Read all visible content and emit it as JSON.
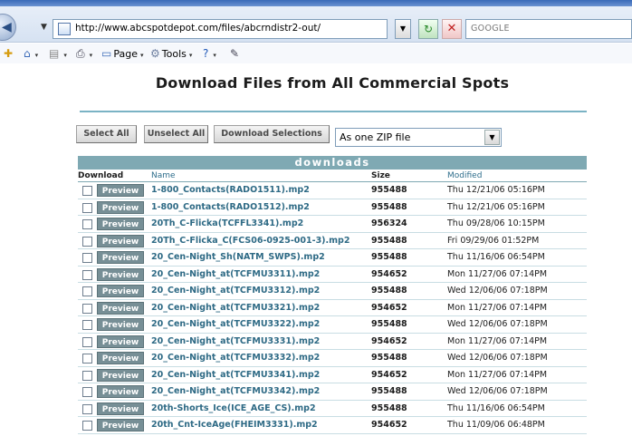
{
  "browser": {
    "url": "http://www.abcspotdepot.com/files/abcrndistr2-out/",
    "search_text": "GOOGLE",
    "back_glyph": "◀",
    "dropdown_glyph": "▼",
    "refresh_glyph": "↻",
    "stop_glyph": "✕",
    "commands": {
      "page": "Page",
      "tools": "Tools"
    },
    "icons": {
      "favorites": "✚",
      "home": "⌂",
      "feeds": "▤",
      "print": "⎙",
      "page": "▭",
      "tools": "⚙",
      "help": "?",
      "research": "✎",
      "dropdown": "▾"
    }
  },
  "page": {
    "title": "Download Files from All Commercial Spots",
    "buttons": {
      "select_all": "Select All",
      "unselect_all": "Unselect All",
      "download_selections": "Download Selections"
    },
    "format_select": {
      "value": "As one ZIP file",
      "arrow": "▼"
    }
  },
  "table": {
    "title": "downloads",
    "columns": {
      "download": "Download",
      "name": "Name",
      "size": "Size",
      "modified": "Modified"
    },
    "preview_label": "Preview",
    "rows": [
      {
        "name": "1-800_Contacts(RADO1511).mp2",
        "size": "955488",
        "modified": "Thu 12/21/06 05:16PM"
      },
      {
        "name": "1-800_Contacts(RADO1512).mp2",
        "size": "955488",
        "modified": "Thu 12/21/06 05:16PM"
      },
      {
        "name": "20Th_C-Flicka(TCFFL3341).mp2",
        "size": "956324",
        "modified": "Thu 09/28/06 10:15PM"
      },
      {
        "name": "20Th_C-Flicka_C(FCS06-0925-001-3).mp2",
        "size": "955488",
        "modified": "Fri 09/29/06 01:52PM"
      },
      {
        "name": "20_Cen-Night_Sh(NATM_SWPS).mp2",
        "size": "955488",
        "modified": "Thu 11/16/06 06:54PM"
      },
      {
        "name": "20_Cen-Night_at(TCFMU3311).mp2",
        "size": "954652",
        "modified": "Mon 11/27/06 07:14PM"
      },
      {
        "name": "20_Cen-Night_at(TCFMU3312).mp2",
        "size": "955488",
        "modified": "Wed 12/06/06 07:18PM"
      },
      {
        "name": "20_Cen-Night_at(TCFMU3321).mp2",
        "size": "954652",
        "modified": "Mon 11/27/06 07:14PM"
      },
      {
        "name": "20_Cen-Night_at(TCFMU3322).mp2",
        "size": "955488",
        "modified": "Wed 12/06/06 07:18PM"
      },
      {
        "name": "20_Cen-Night_at(TCFMU3331).mp2",
        "size": "954652",
        "modified": "Mon 11/27/06 07:14PM"
      },
      {
        "name": "20_Cen-Night_at(TCFMU3332).mp2",
        "size": "955488",
        "modified": "Wed 12/06/06 07:18PM"
      },
      {
        "name": "20_Cen-Night_at(TCFMU3341).mp2",
        "size": "954652",
        "modified": "Mon 11/27/06 07:14PM"
      },
      {
        "name": "20_Cen-Night_at(TCFMU3342).mp2",
        "size": "955488",
        "modified": "Wed 12/06/06 07:18PM"
      },
      {
        "name": "20th-Shorts_Ice(ICE_AGE_CS).mp2",
        "size": "955488",
        "modified": "Thu 11/16/06 06:54PM"
      },
      {
        "name": "20th_Cnt-IceAge(FHEIM3331).mp2",
        "size": "954652",
        "modified": "Thu 11/09/06 06:48PM"
      }
    ]
  }
}
